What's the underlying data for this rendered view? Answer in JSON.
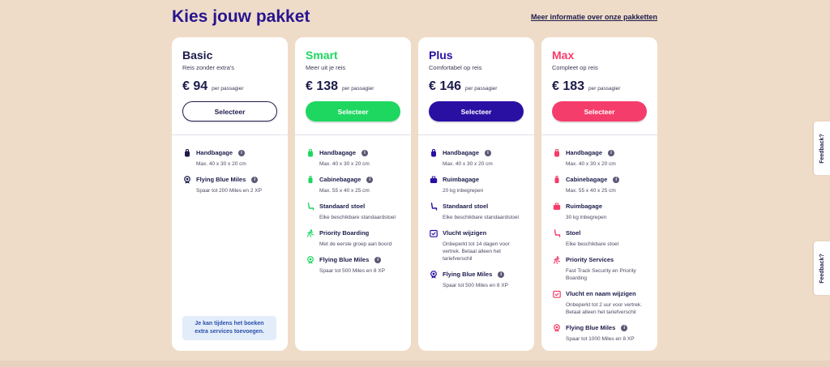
{
  "header": {
    "title": "Kies jouw pakket",
    "more_link": "Meer informatie over onze pakketten"
  },
  "packages": [
    {
      "name": "Basic",
      "subtitle": "Reis zonder extra's",
      "price": "€ 94",
      "price_unit": "per passagier",
      "select_label": "Selecteer",
      "accent": "#1c1b4b",
      "button_style": "outline",
      "features": [
        {
          "title": "Handbagage",
          "desc": "Max. 40 x 30 x 20 cm",
          "icon": "backpack-icon",
          "info": true
        },
        {
          "title": "Flying Blue Miles",
          "desc": "Spaar tot 200 Miles en 2 XP",
          "icon": "medal-icon",
          "info": true
        }
      ],
      "note": "Je kan tijdens het boeken extra services toevoegen."
    },
    {
      "name": "Smart",
      "subtitle": "Meer uit je reis",
      "price": "€ 138",
      "price_unit": "per passagier",
      "select_label": "Selecteer",
      "accent": "#1ed760",
      "button_style": "filled",
      "features": [
        {
          "title": "Handbagage",
          "desc": "Max. 40 x 30 x 20 cm",
          "icon": "backpack-icon",
          "info": true
        },
        {
          "title": "Cabinebagage",
          "desc": "Max. 55 x 40 x 25 cm",
          "icon": "trolley-icon",
          "info": true
        },
        {
          "title": "Standaard stoel",
          "desc": "Elke beschikbare standaardstoel",
          "icon": "seat-icon",
          "info": false
        },
        {
          "title": "Priority Boarding",
          "desc": "Met de eerste groep aan boord",
          "icon": "boarding-icon",
          "info": false
        },
        {
          "title": "Flying Blue Miles",
          "desc": "Spaar tot 500 Miles en 8 XP",
          "icon": "medal-icon",
          "info": true
        }
      ]
    },
    {
      "name": "Plus",
      "subtitle": "Comfortabel op reis",
      "price": "€ 146",
      "price_unit": "per passagier",
      "select_label": "Selecteer",
      "accent": "#2a0fa3",
      "button_style": "filled",
      "features": [
        {
          "title": "Handbagage",
          "desc": "Max. 40 x 30 x 20 cm",
          "icon": "backpack-icon",
          "info": true
        },
        {
          "title": "Ruimbagage",
          "desc": "20 kg inbegrepen",
          "icon": "suitcase-icon",
          "info": false
        },
        {
          "title": "Standaard stoel",
          "desc": "Elke beschikbare standaardstoel",
          "icon": "seat-icon",
          "info": false
        },
        {
          "title": "Vlucht wijzigen",
          "desc": "Onbeperkt tot 14 dagen voor vertrek. Betaal alleen het tariefverschil",
          "icon": "calendar-icon",
          "info": false
        },
        {
          "title": "Flying Blue Miles",
          "desc": "Spaar tot 500 Miles en 8 XP",
          "icon": "medal-icon",
          "info": true
        }
      ]
    },
    {
      "name": "Max",
      "subtitle": "Compleet op reis",
      "price": "€ 183",
      "price_unit": "per passagier",
      "select_label": "Selecteer",
      "accent": "#f53d6b",
      "button_style": "filled",
      "features": [
        {
          "title": "Handbagage",
          "desc": "Max. 40 x 30 x 20 cm",
          "icon": "backpack-icon",
          "info": true
        },
        {
          "title": "Cabinebagage",
          "desc": "Max. 55 x 40 x 25 cm",
          "icon": "trolley-icon",
          "info": true
        },
        {
          "title": "Ruimbagage",
          "desc": "30 kg inbegrepen",
          "icon": "suitcase-icon",
          "info": false
        },
        {
          "title": "Stoel",
          "desc": "Elke beschikbare stoel",
          "icon": "seat-icon",
          "info": false
        },
        {
          "title": "Priority Services",
          "desc": "Fast Track Security en Priority Boarding",
          "icon": "boarding-icon",
          "info": false
        },
        {
          "title": "Vlucht en naam wijzigen",
          "desc": "Onbeperkt tot 2 uur voor vertrek. Betaal alleen het tariefverschil",
          "icon": "calendar-icon",
          "info": false
        },
        {
          "title": "Flying Blue Miles",
          "desc": "Spaar tot 1000 Miles en 8 XP",
          "icon": "medal-icon",
          "info": true
        }
      ]
    }
  ],
  "feedback": {
    "label": "Feedback?"
  }
}
